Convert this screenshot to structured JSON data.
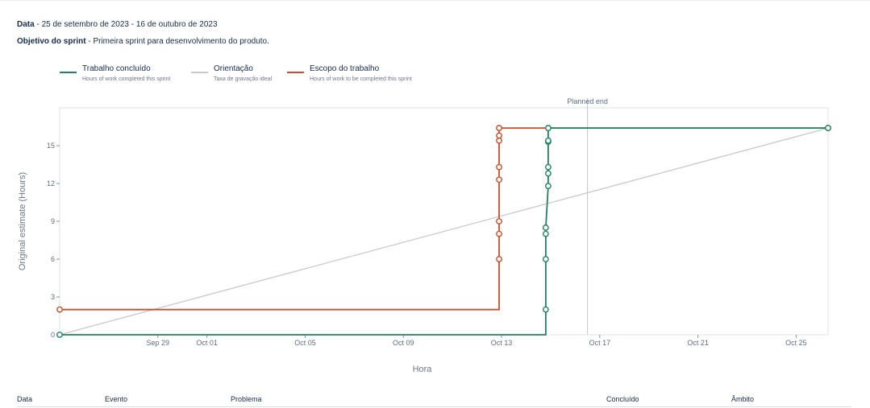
{
  "header": {
    "date_label": "Data",
    "date_value": " - 25 de setembro de 2023 - 16 de outubro de 2023",
    "goal_label": "Objetivo do sprint",
    "goal_value": " - Primeira sprint para desenvolvimento do produto."
  },
  "legend": [
    {
      "name": "Trabalho concluído",
      "desc": "Hours of work completed this sprint",
      "color": "#1e8560"
    },
    {
      "name": "Orientação",
      "desc": "Taxa de gravação ideal",
      "color": "#c9c9c9"
    },
    {
      "name": "Escopo do trabalho",
      "desc": "Hours of work to be completed this sprint",
      "color": "#d04c27"
    }
  ],
  "table": {
    "headers": [
      "Data",
      "Evento",
      "Problema",
      "Concluído",
      "Âmbito"
    ]
  },
  "chart_data": {
    "type": "line",
    "xlabel": "Hora",
    "ylabel": "Original estimate (Hours)",
    "x_ticks": [
      "Sep 29",
      "Oct 01",
      "Oct 05",
      "Oct 09",
      "Oct 13",
      "Oct 17",
      "Oct 21",
      "Oct 25"
    ],
    "x_tick_days": [
      4,
      6,
      10,
      14,
      18,
      22,
      26,
      30
    ],
    "y_ticks": [
      0,
      3,
      6,
      9,
      12,
      15
    ],
    "xlim_days": [
      0,
      31.3
    ],
    "ylim": [
      0,
      18
    ],
    "planned_end_label": "Planned end",
    "planned_end_day": 21.5,
    "series": [
      {
        "name": "Trabalho concluído",
        "color": "#1e8560",
        "x": [
          0,
          19.8,
          19.8,
          19.8,
          19.8,
          19.8,
          19.9,
          19.9,
          19.9,
          19.9,
          19.9,
          19.9,
          19.9,
          31.3
        ],
        "y": [
          0,
          0,
          2,
          6,
          8,
          8.5,
          11.8,
          12.8,
          13.3,
          15.3,
          15.4,
          16.4,
          16.4,
          16.4
        ],
        "markers": [
          1,
          0,
          1,
          1,
          1,
          1,
          1,
          1,
          1,
          1,
          1,
          1,
          0,
          1
        ]
      },
      {
        "name": "Orientação",
        "color": "#c9c9c9",
        "x": [
          0,
          31.3
        ],
        "y": [
          0,
          16.4
        ],
        "markers": [
          0,
          0
        ]
      },
      {
        "name": "Escopo do trabalho",
        "color": "#d04c27",
        "x": [
          0,
          17.9,
          17.9,
          17.9,
          17.9,
          17.9,
          17.9,
          17.9,
          17.9,
          17.9,
          17.9,
          31.3
        ],
        "y": [
          2,
          2,
          6,
          8,
          9,
          12.3,
          13.3,
          15.4,
          15.8,
          16.4,
          16.4,
          16.4
        ],
        "markers": [
          1,
          0,
          1,
          1,
          1,
          1,
          1,
          1,
          1,
          1,
          0,
          1
        ]
      }
    ]
  }
}
